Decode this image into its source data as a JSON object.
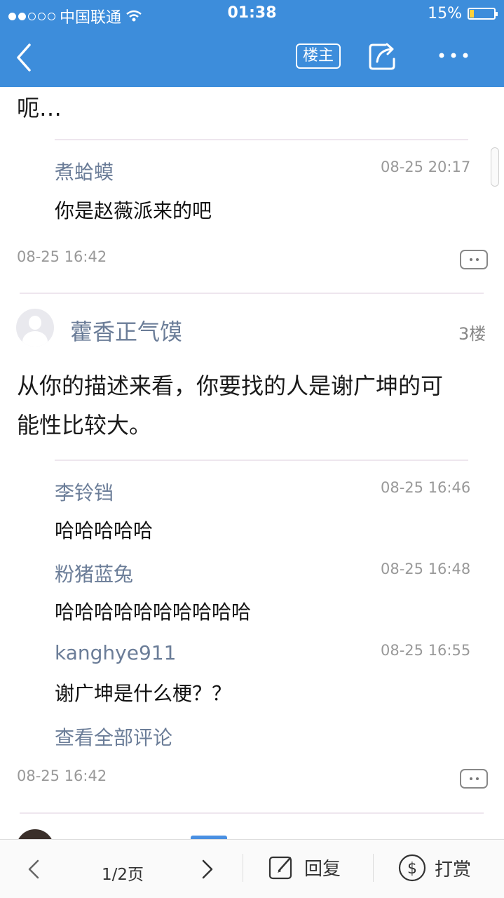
{
  "status_bar": {
    "carrier": "中国联通",
    "time": "01:38",
    "battery": "15%",
    "signal_bars": 2
  },
  "nav": {
    "owner_label": "楼主",
    "icons": [
      "back-arrow-icon",
      "share-icon",
      "more-icon"
    ]
  },
  "top_post": {
    "text_tail": "呃…",
    "comments": [
      {
        "name": "煮蛤蟆",
        "time": "08-25 20:17",
        "text": "你是赵薇派来的吧"
      }
    ],
    "time": "08-25 16:42"
  },
  "post3": {
    "user": "藿香正气馍",
    "floor": "3楼",
    "text_line1": "从你的描述来看，你要找的人是谢广坤的可",
    "text_line2": "能性比较大。",
    "comments": [
      {
        "name": "李铃铛",
        "time": "08-25 16:46",
        "text": "哈哈哈哈哈"
      },
      {
        "name": "粉猪蓝兔",
        "time": "08-25 16:48",
        "text": "哈哈哈哈哈哈哈哈哈哈"
      },
      {
        "name": "kanghye911",
        "time": "08-25 16:55",
        "text": "谢广坤是什么梗？？"
      }
    ],
    "view_all": "查看全部评论",
    "time": "08-25 16:42"
  },
  "bottom_bar": {
    "page": "1/2页",
    "reply": "回复",
    "reward": "打赏"
  },
  "colors": {
    "header_blue": "#3d8ddb",
    "username_gray_blue": "#6b7d98",
    "timestamp_gray": "#999999"
  }
}
